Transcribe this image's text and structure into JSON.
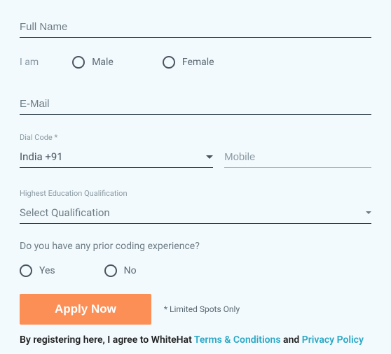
{
  "fields": {
    "full_name_placeholder": "Full Name",
    "iam_label": "I am",
    "gender_male": "Male",
    "gender_female": "Female",
    "email_placeholder": "E-Mail",
    "dial_code_label": "Dial Code *",
    "dial_code_value": "India +91",
    "mobile_placeholder": "Mobile",
    "qual_label": "Highest Education Qualification",
    "qual_value": "Select Qualification",
    "coding_question": "Do you have any prior coding experience?",
    "yes": "Yes",
    "no": "No"
  },
  "cta": {
    "apply": "Apply Now",
    "limited": "* Limited Spots Only"
  },
  "agreement": {
    "prefix": "By registering here, I agree to WhiteHat ",
    "terms": "Terms & Conditions",
    "and": " and ",
    "privacy": "Privacy Policy"
  }
}
